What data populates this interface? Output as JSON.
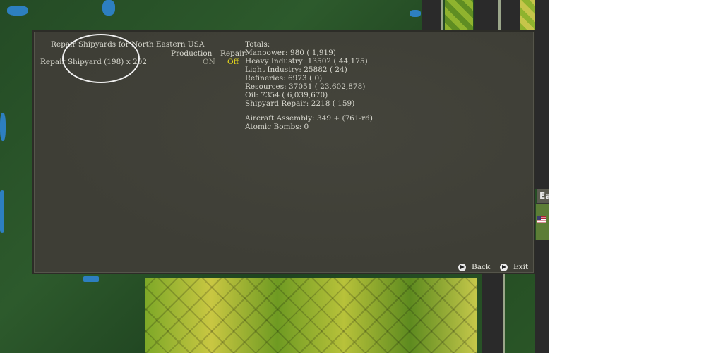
{
  "dialog": {
    "title": "Repair Shipyards for North Eastern USA",
    "headers": {
      "production": "Production",
      "repair": "Repair"
    },
    "item": {
      "name": "Repair Shipyard (198) x 202",
      "production": "ON",
      "repair": "Off"
    },
    "totals": {
      "heading": "Totals:",
      "lines": [
        "Manpower: 980 ( 1,919)",
        "Heavy Industry: 13502 ( 44,175)",
        "Light Industry: 25882 ( 24)",
        "Refineries: 6973 ( 0)",
        "Resources: 37051 ( 23,602,878)",
        "Oil: 7354 ( 6,039,670)",
        "Shipyard Repair: 2218 ( 159)"
      ],
      "extra_lines": [
        "Aircraft Assembly: 349 + (761-rd)",
        "Atomic Bombs: 0"
      ]
    },
    "buttons": {
      "back": "Back",
      "exit": "Exit"
    }
  },
  "map": {
    "edge_label": "Ea"
  },
  "colors": {
    "panel_bg": "#3e3e36",
    "text": "#d8d8cf",
    "repair_off": "#e7d91c",
    "production_on": "#a9a99b",
    "water": "#2d7fc0"
  }
}
